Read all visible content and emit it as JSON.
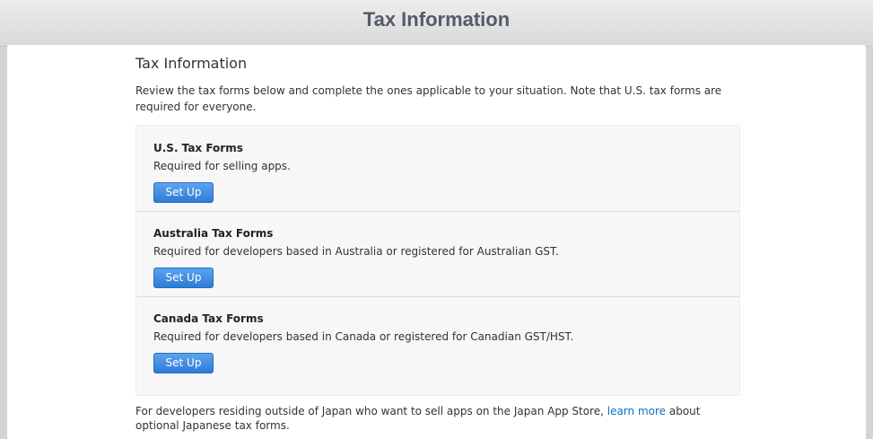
{
  "window": {
    "title": "Tax Information"
  },
  "page": {
    "heading": "Tax Information",
    "intro": "Review the tax forms below and complete the ones applicable to your situation. Note that U.S. tax forms are required for everyone."
  },
  "forms": [
    {
      "title": "U.S. Tax Forms",
      "description": "Required for selling apps.",
      "button_label": "Set Up"
    },
    {
      "title": "Australia Tax Forms",
      "description": "Required for developers based in Australia or registered for Australian GST.",
      "button_label": "Set Up"
    },
    {
      "title": "Canada Tax Forms",
      "description": "Required for developers based in Canada or registered for Canadian GST/HST.",
      "button_label": "Set Up"
    }
  ],
  "footer": {
    "text_before": "For developers residing outside of Japan who want to sell apps on the Japan App Store, ",
    "link_label": "learn more",
    "text_after": " about optional Japanese tax forms."
  },
  "colors": {
    "button": "#2d7bd6",
    "link": "#0f6ec6",
    "title": "#545c66"
  }
}
